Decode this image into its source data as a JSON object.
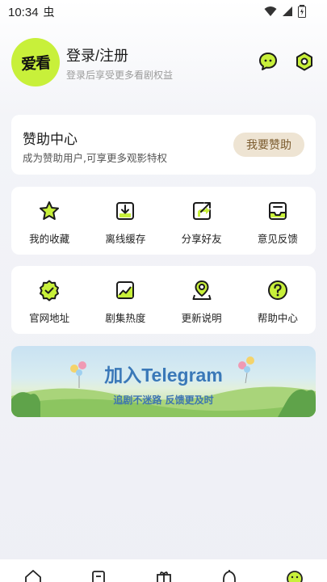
{
  "status_bar": {
    "time": "10:34",
    "notification_glyph": "虫"
  },
  "profile": {
    "avatar_text": "爱看",
    "login_label": "登录/注册",
    "login_hint": "登录后享受更多看剧权益"
  },
  "sponsor": {
    "title": "赞助中心",
    "subtitle": "成为赞助用户,可享更多观影特权",
    "button_label": "我要赞助"
  },
  "features_row1": [
    {
      "label": "我的收藏",
      "icon": "star-icon"
    },
    {
      "label": "离线缓存",
      "icon": "download-icon"
    },
    {
      "label": "分享好友",
      "icon": "share-icon"
    },
    {
      "label": "意见反馈",
      "icon": "inbox-icon"
    }
  ],
  "features_row2": [
    {
      "label": "官网地址",
      "icon": "verified-badge-icon"
    },
    {
      "label": "剧集热度",
      "icon": "trend-chart-icon"
    },
    {
      "label": "更新说明",
      "icon": "location-person-icon"
    },
    {
      "label": "帮助中心",
      "icon": "help-icon"
    }
  ],
  "banner": {
    "title": "加入Telegram",
    "subtitle": "追剧不迷路 反馈更及时"
  },
  "bottom_nav": [
    "home-icon",
    "list-icon",
    "gift-icon",
    "bell-icon",
    "mine-icon"
  ],
  "colors": {
    "accent": "#c8f03a",
    "sponsor_button_bg": "#eee4d3",
    "sponsor_button_text": "#7a5a2c",
    "banner_text": "#3a78b8"
  }
}
